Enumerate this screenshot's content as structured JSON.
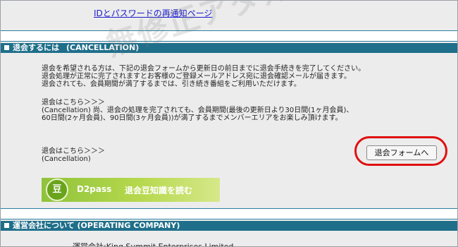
{
  "top_link": "IDとパスワードの再通知ページ",
  "cancellation": {
    "header_jp": "退会するには",
    "header_en": "(CANCELLATION)",
    "para1": [
      "退会を希望される方は、下記の退会フォームから更新日の前日までに退会手続きを完了してください。",
      "退会処理が正常に完了されますとお客様のご登録メールアドレス宛に退会確認メールが届きます。",
      "退会されても、会員期間が満了するまでは、引き続き番組をご利用いただけます。"
    ],
    "para2": [
      "退会はこちら＞＞＞",
      "(Cancellation) 尚、退会の処理を完了されても、会員期間(最後の更新日より30日間(1ヶ月会員)、",
      "60日間(2ヶ月会員)、90日間(3ヶ月会員))が満了するまでメンバーエリアをお楽しみ頂けます。"
    ],
    "cancel_label": [
      "退会はこちら＞＞＞",
      "(Cancellation)"
    ],
    "cancel_button": "退会フォームへ",
    "d2pass_badge": "豆",
    "d2pass_brand": "D2pass",
    "d2pass_cta": "退会豆知識を読む"
  },
  "operating": {
    "header": "運営会社について (OPERATING COMPANY)",
    "company_line": "運営会社:King Summit Enterprises Limited"
  },
  "watermark": "無修正アダルト動画部！",
  "colors": {
    "header_bg": "#1f6f8b",
    "body_bg": "#ececec",
    "link": "#1a1acc",
    "highlight_circle": "#e01010",
    "d2pass_green": "#8fc33b"
  }
}
